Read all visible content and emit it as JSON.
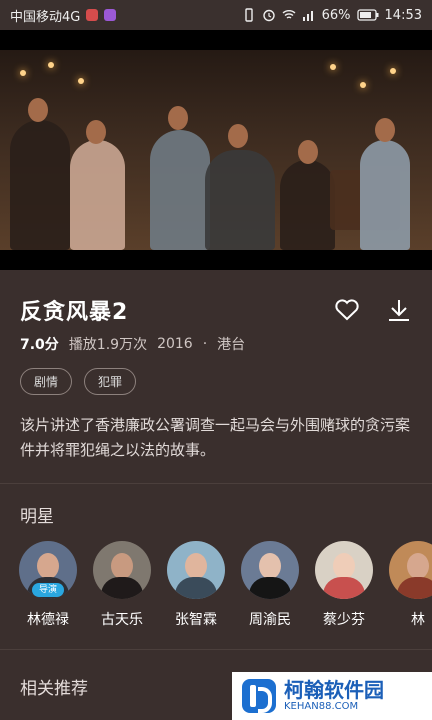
{
  "status": {
    "carrier": "中国移动4G",
    "battery": "66%",
    "time": "14:53"
  },
  "video": {
    "description": ""
  },
  "movie": {
    "title": "反贪风暴2",
    "score": "7.0分",
    "plays": "播放1.9万次",
    "year": "2016",
    "separator": "·",
    "region": "港台",
    "tags": [
      "剧情",
      "犯罪"
    ],
    "synopsis": "该片讲述了香港廉政公署调查一起马会与外围赌球的贪污案件并将罪犯绳之以法的故事。"
  },
  "stars_section": {
    "title": "明星",
    "people": [
      {
        "name": "林德禄",
        "badge": "导演"
      },
      {
        "name": "古天乐"
      },
      {
        "name": "张智霖"
      },
      {
        "name": "周渝民"
      },
      {
        "name": "蔡少芬"
      },
      {
        "name": "林"
      }
    ]
  },
  "related": {
    "title": "相关推荐"
  },
  "watermark": {
    "title": "柯翰软件园",
    "sub": "KEHAN88.COM"
  },
  "icons": [
    "heart-icon",
    "download-icon",
    "wifi-icon",
    "battery-icon",
    "alarm-icon",
    "vibrate-icon"
  ]
}
